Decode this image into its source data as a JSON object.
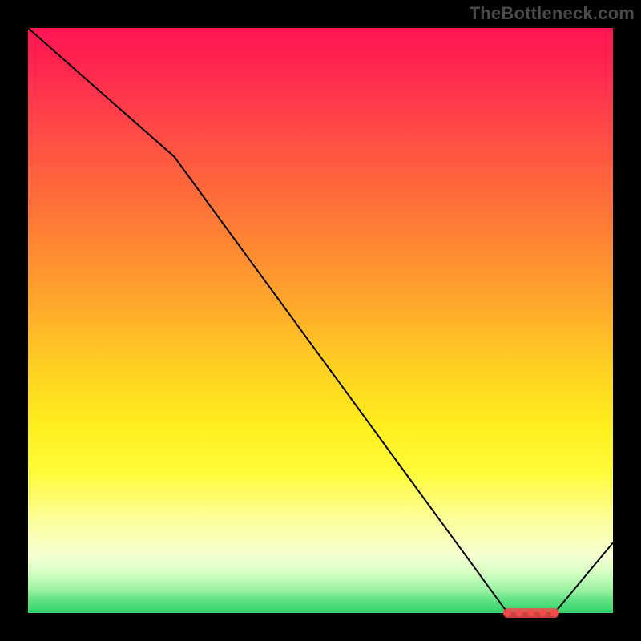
{
  "watermark": "TheBottleneck.com",
  "chart_data": {
    "type": "line",
    "title": "",
    "xlabel": "",
    "ylabel": "",
    "xlim": [
      0,
      100
    ],
    "ylim": [
      0,
      100
    ],
    "grid": false,
    "legend": false,
    "series": [
      {
        "name": "curve",
        "x": [
          0,
          25,
          82,
          90,
          100
        ],
        "y": [
          100,
          78,
          0,
          0,
          12
        ],
        "stroke": "#000000",
        "width": 2
      }
    ],
    "markers": {
      "name": "optimal-band",
      "shape": "round-rect",
      "color": "#ef4b4b",
      "x_range": [
        82,
        90
      ],
      "y": 0,
      "samples_x": [
        82,
        84,
        86,
        88,
        90
      ]
    },
    "background_gradient": {
      "direction": "top-to-bottom",
      "stops": [
        {
          "pos": 0.0,
          "color": "#ff1452"
        },
        {
          "pos": 0.5,
          "color": "#ffab2a"
        },
        {
          "pos": 0.75,
          "color": "#ffee1e"
        },
        {
          "pos": 0.9,
          "color": "#f6ffd0"
        },
        {
          "pos": 1.0,
          "color": "#2fd46a"
        }
      ]
    }
  }
}
